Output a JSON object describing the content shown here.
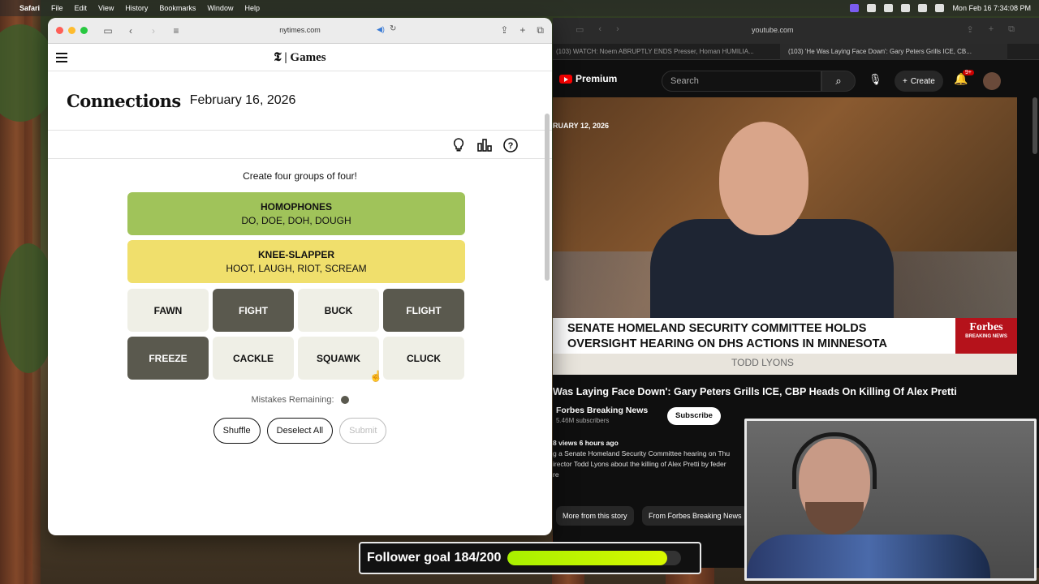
{
  "menubar": {
    "app_name": "Safari",
    "items": [
      "File",
      "Edit",
      "View",
      "History",
      "Bookmarks",
      "Window",
      "Help"
    ],
    "clock": "Mon Feb 16  7:34:08 PM"
  },
  "safari": {
    "url": "nytimes.com",
    "brand": "Games",
    "game_title": "Connections",
    "game_date": "February 16, 2026",
    "instructions": "Create four groups of four!",
    "solved": [
      {
        "category": "HOMOPHONES",
        "words": "DO, DOE, DOH, DOUGH",
        "color": "#a0c35a"
      },
      {
        "category": "KNEE-SLAPPER",
        "words": "HOOT, LAUGH, RIOT, SCREAM",
        "color": "#f0df6c"
      }
    ],
    "tiles": [
      {
        "word": "FAWN",
        "selected": false
      },
      {
        "word": "FIGHT",
        "selected": true
      },
      {
        "word": "BUCK",
        "selected": false
      },
      {
        "word": "FLIGHT",
        "selected": true
      },
      {
        "word": "FREEZE",
        "selected": true
      },
      {
        "word": "CACKLE",
        "selected": false
      },
      {
        "word": "SQUAWK",
        "selected": false
      },
      {
        "word": "CLUCK",
        "selected": false
      }
    ],
    "mistakes_label": "Mistakes Remaining:",
    "mistakes_remaining": 1,
    "buttons": {
      "shuffle": "Shuffle",
      "deselect": "Deselect All",
      "submit": "Submit"
    }
  },
  "youtube": {
    "url": "youtube.com",
    "tabs": [
      "(103) WATCH: Noem ABRUPTLY ENDS Presser, Homan HUMILIA...",
      "(103) 'He Was Laying Face Down': Gary Peters Grills ICE, CB..."
    ],
    "logo_text": "Premium",
    "search_placeholder": "Search",
    "create_label": "Create",
    "notifications": "9+",
    "video_date": "RUARY 12, 2026",
    "chyron_line1": "SENATE HOMELAND SECURITY COMMITTEE HOLDS",
    "chyron_line2": "OVERSIGHT HEARING ON DHS ACTIONS IN MINNESOTA",
    "chyron_brand": "Forbes",
    "chyron_brand_sub": "BREAKING NEWS",
    "chyron_name": "TODD LYONS",
    "video_title": "Was Laying Face Down': Gary Peters Grills ICE, CBP Heads On Killing Of Alex Pretti",
    "channel_name": "Forbes Breaking News",
    "subscribers": "5.46M subscribers",
    "subscribe_label": "Subscribe",
    "views_line": "8 views  6 hours ago",
    "desc_line1": "g a Senate Homeland Security Committee hearing on Thu",
    "desc_line2": "irector Todd Lyons about the killing of Alex Pretti by feder",
    "desc_more": "re",
    "chip1": "More from this story",
    "chip2": "From Forbes Breaking News"
  },
  "follower_goal": {
    "label": "Follower goal 184/200",
    "current": 184,
    "target": 200
  }
}
